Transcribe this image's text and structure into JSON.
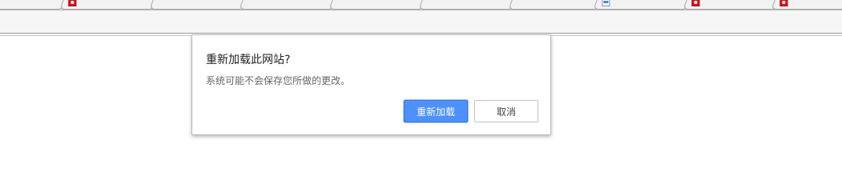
{
  "browser": {
    "tabs": [
      {
        "favicon": "blank-page-icon",
        "title": ""
      },
      {
        "favicon": "red-logo-icon",
        "title": ""
      },
      {
        "favicon": "blank-page-icon",
        "title": ""
      },
      {
        "favicon": "blank-page-icon",
        "title": ""
      },
      {
        "favicon": "blank-page-icon",
        "title": ""
      },
      {
        "favicon": "blank-page-icon",
        "title": ""
      },
      {
        "favicon": "blank-page-icon",
        "title": ""
      },
      {
        "favicon": "blue-page-icon",
        "title": ""
      },
      {
        "favicon": "red-logo-icon",
        "title": ""
      },
      {
        "favicon": "red-logo-icon",
        "title": ""
      }
    ]
  },
  "dialog": {
    "title": "重新加载此网站?",
    "message": "系统可能不会保存您所做的更改。",
    "reload_label": "重新加载",
    "cancel_label": "取消"
  },
  "colors": {
    "primary_button": "#4d90fe",
    "dialog_border": "#b8b8b8",
    "tab_background": "#f2f2f2"
  }
}
